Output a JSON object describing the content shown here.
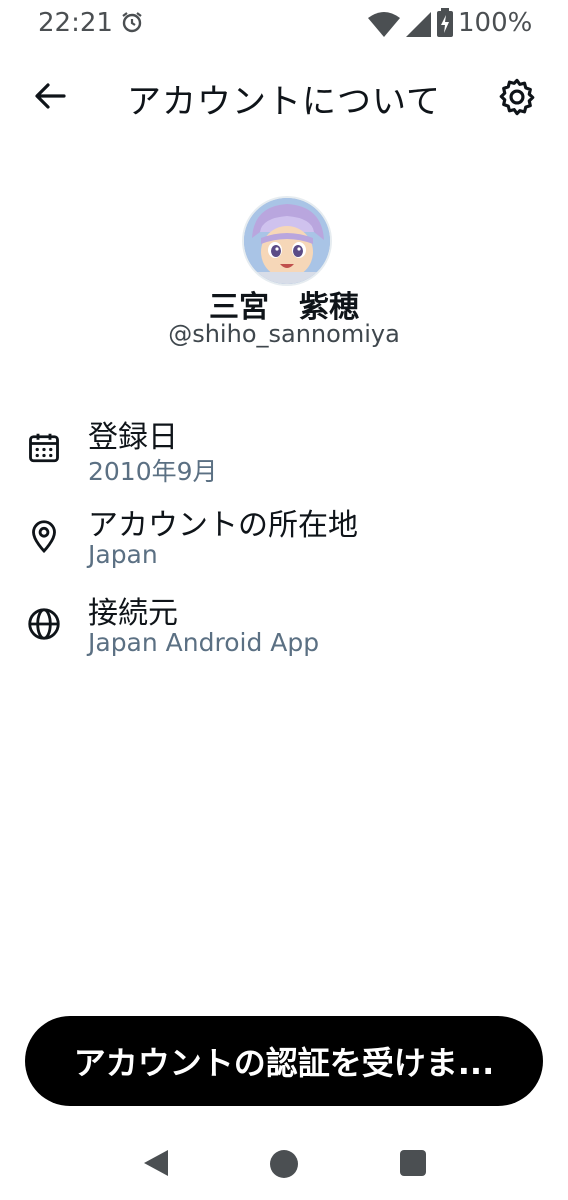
{
  "status_bar": {
    "time": "22:21",
    "battery": "100%"
  },
  "header": {
    "title": "アカウントについて"
  },
  "profile": {
    "display_name": "三宮　紫穂",
    "handle": "@shiho_sannomiya"
  },
  "info_items": [
    {
      "icon": "calendar-icon",
      "label": "登録日",
      "value": "2010年9月"
    },
    {
      "icon": "location-pin-icon",
      "label": "アカウントの所在地",
      "value": "Japan"
    },
    {
      "icon": "globe-icon",
      "label": "接続元",
      "value": "Japan Android App"
    }
  ],
  "cta": {
    "label": "アカウントの認証を受けま..."
  },
  "colors": {
    "primary_text": "#0f1419",
    "secondary_text": "#5b7083",
    "button_bg": "#000000"
  }
}
